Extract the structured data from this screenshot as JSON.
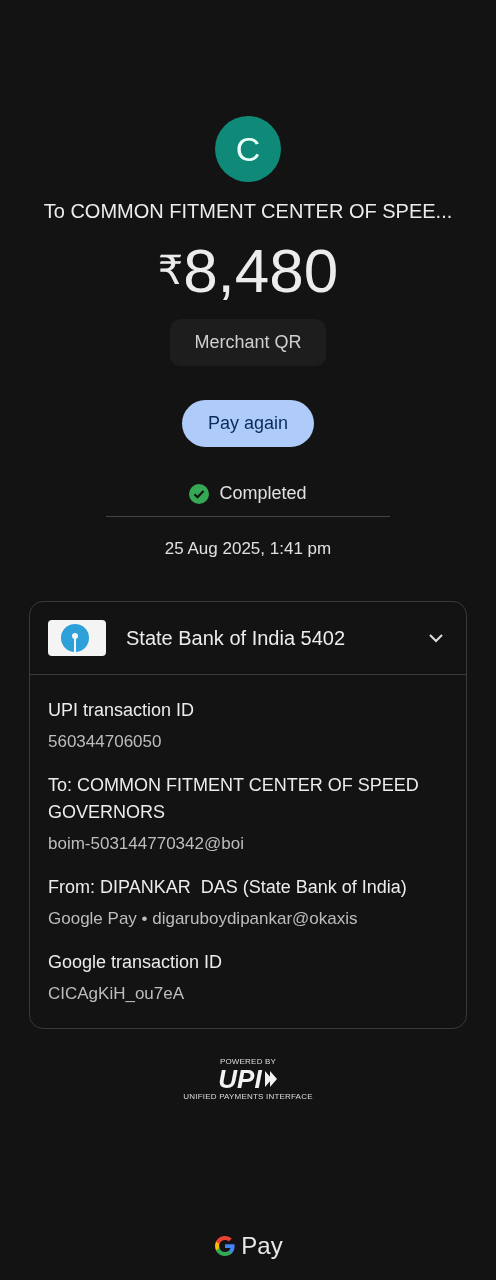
{
  "avatar": {
    "initial": "C",
    "color": "#0f8a78"
  },
  "recipient": "To COMMON FITMENT CENTER OF SPEE...",
  "amount": {
    "currency": "₹",
    "value": "8,480"
  },
  "tag": "Merchant QR",
  "action": "Pay again",
  "status": {
    "label": "Completed",
    "kind": "success"
  },
  "datetime": "25 Aug 2025, 1:41 pm",
  "account": {
    "name": "State Bank of India 5402",
    "expanded": true
  },
  "details": [
    {
      "label": "UPI transaction ID",
      "value": "560344706050"
    },
    {
      "label": "To: COMMON FITMENT CENTER OF SPEED GOVERNORS",
      "value": "boim-503144770342@boi"
    },
    {
      "label": "From: DIPANKAR  DAS (State Bank of India)",
      "value": "Google Pay • digaruboydipankar@okaxis"
    },
    {
      "label": "Google transaction ID",
      "value": "CICAgKiH_ou7eA"
    }
  ],
  "upi_badge": {
    "top": "POWERED BY",
    "mark": "UPI",
    "bottom": "UNIFIED PAYMENTS INTERFACE"
  },
  "footer": {
    "brand": "Pay"
  }
}
